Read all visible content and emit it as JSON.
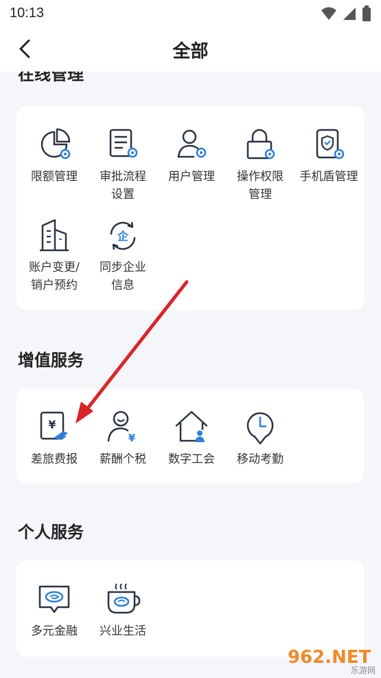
{
  "status_bar": {
    "time": "10:13"
  },
  "nav": {
    "title": "全部"
  },
  "sections": {
    "online": {
      "title": "在线管理",
      "items": [
        {
          "label": "限额管理",
          "icon": "quota-pie-icon"
        },
        {
          "label": "审批流程\n设置",
          "icon": "approval-doc-icon"
        },
        {
          "label": "用户管理",
          "icon": "user-gear-icon"
        },
        {
          "label": "操作权限\n管理",
          "icon": "lock-gear-icon"
        },
        {
          "label": "手机盾管理",
          "icon": "phone-shield-icon"
        },
        {
          "label": "账户变更/\n销户预约",
          "icon": "building-icon"
        },
        {
          "label": "同步企业\n信息",
          "icon": "sync-enterprise-icon"
        }
      ]
    },
    "value_added": {
      "title": "增值服务",
      "items": [
        {
          "label": "差旅费报",
          "icon": "travel-expense-icon"
        },
        {
          "label": "薪酬个税",
          "icon": "salary-tax-icon"
        },
        {
          "label": "数字工会",
          "icon": "digital-union-icon"
        },
        {
          "label": "移动考勤",
          "icon": "attendance-clock-icon"
        }
      ]
    },
    "personal": {
      "title": "个人服务",
      "items": [
        {
          "label": "多元金融",
          "icon": "finance-chat-icon"
        },
        {
          "label": "兴业生活",
          "icon": "life-cup-icon"
        }
      ]
    }
  },
  "watermark": {
    "text": "962.NET",
    "sub": "乐游网"
  },
  "colors": {
    "accent": "#2f7fd8",
    "icon_stroke": "#2a3342",
    "arrow": "#d9252a",
    "background": "#f5f6fa"
  }
}
